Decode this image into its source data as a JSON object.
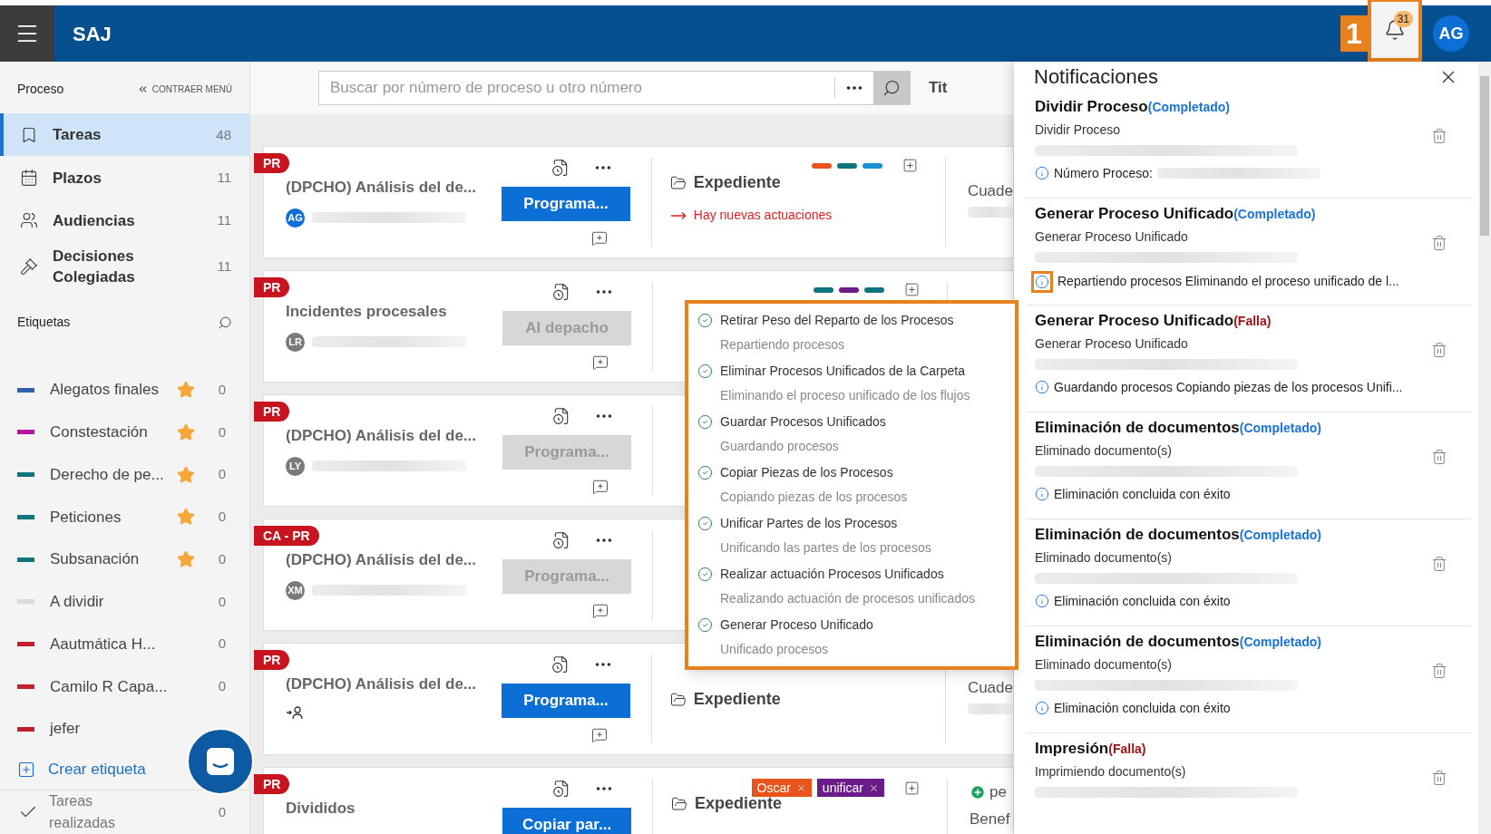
{
  "header": {
    "app_name": "SAJ",
    "callout": "1",
    "notification_count": "31",
    "user_initials": "AG"
  },
  "sidebar": {
    "section_title": "Proceso",
    "collapse_label": "CONTRAER MENÚ",
    "nav": [
      {
        "kind": "tasks",
        "label": "Tareas",
        "count": "48",
        "selected": true
      },
      {
        "kind": "calendar",
        "label": "Plazos",
        "count": "11",
        "selected": false
      },
      {
        "kind": "people",
        "label": "Audiencias",
        "count": "11",
        "selected": false
      },
      {
        "kind": "gavel",
        "label": "Decisiones Colegiadas",
        "count": "11",
        "selected": false
      }
    ],
    "labels_title": "Etiquetas",
    "labels": [
      {
        "name": "Alegatos finales",
        "color": "#2f5fae",
        "starred": true,
        "count": "0"
      },
      {
        "name": "Constestación",
        "color": "#b4169f",
        "starred": true,
        "count": "0"
      },
      {
        "name": "Derecho de pe...",
        "color": "#0e7480",
        "starred": true,
        "count": "0"
      },
      {
        "name": "Peticiones",
        "color": "#0e7480",
        "starred": true,
        "count": "0"
      },
      {
        "name": "Subsanación",
        "color": "#0e7480",
        "starred": true,
        "count": "0"
      },
      {
        "name": "A dividir",
        "color": "#dcdcdc",
        "starred": false,
        "count": "0"
      },
      {
        "name": "Aautmática H...",
        "color": "#c0202a",
        "starred": false,
        "count": "0"
      },
      {
        "name": "Camilo R Capa...",
        "color": "#c0202a",
        "starred": false,
        "count": "0"
      },
      {
        "name": "jefer",
        "color": "#c0202a",
        "starred": false
      }
    ],
    "create_label": "Crear etiqueta",
    "done": {
      "label": "Tareas realizadas",
      "count": "0"
    }
  },
  "search": {
    "placeholder": "Buscar por número de proceso u otro número",
    "column_hint": "Tit"
  },
  "cards": [
    {
      "tag": "PR",
      "title": "(DPCHO) Análisis del de...",
      "assignee": {
        "kind": "user",
        "initials": "AG",
        "color": "#0b6fd6"
      },
      "action": {
        "label": "Programa...",
        "disabled": false
      },
      "color_bars": [
        {
          "color": "#e8541c"
        },
        {
          "color": "#0e7480"
        },
        {
          "color": "#1a8fd8"
        }
      ],
      "folder": "Expediente",
      "alert": "Hay nuevas actuaciones",
      "column_3": [
        "Cuade"
      ]
    },
    {
      "tag": "PR",
      "title": "Incidentes procesales",
      "assignee": {
        "kind": "user",
        "initials": "LR",
        "color": "#7a7a7a"
      },
      "action": {
        "label": "Al depacho",
        "disabled": true
      },
      "color_bars": [
        {
          "color": "#0e7480"
        },
        {
          "color": "#6b1b8a"
        },
        {
          "color": "#0e7480"
        }
      ]
    },
    {
      "tag": "PR",
      "title": "(DPCHO) Análisis del de...",
      "assignee": {
        "kind": "user",
        "initials": "LY",
        "color": "#7a7a7a"
      },
      "action": {
        "label": "Programa...",
        "disabled": true
      }
    },
    {
      "tag": "CA - PR",
      "title": "(DPCHO) Análisis del de...",
      "assignee": {
        "kind": "user",
        "initials": "XM",
        "color": "#7a7a7a"
      },
      "action": {
        "label": "Programa...",
        "disabled": true
      }
    },
    {
      "tag": "PR",
      "title": "(DPCHO) Análisis del de...",
      "assignee": {
        "kind": "unassigned"
      },
      "action": {
        "label": "Programa...",
        "disabled": false
      },
      "folder": "Expediente",
      "column_3": [
        "Cuade"
      ]
    },
    {
      "tag": "PR",
      "title": "Divididos",
      "action": {
        "label": "Copiar par...",
        "disabled": false
      },
      "chips": [
        {
          "label": "Oscar",
          "color": "#e8541c"
        },
        {
          "label": "unificar",
          "color": "#6b1b8a"
        }
      ],
      "folder": "Expediente",
      "column_3": [
        "pe",
        "Benef"
      ]
    }
  ],
  "steps_popup": [
    {
      "title": "Retirar Peso del Reparto de los Procesos",
      "subtitle": "Repartiendo procesos"
    },
    {
      "title": "Eliminar Procesos Unificados de la Carpeta",
      "subtitle": "Eliminando el proceso unificado de los flujos"
    },
    {
      "title": "Guardar Procesos Unificados",
      "subtitle": "Guardando procesos"
    },
    {
      "title": "Copiar Piezas de los Procesos",
      "subtitle": "Copiando piezas de los procesos"
    },
    {
      "title": "Unificar Partes de los Procesos",
      "subtitle": "Unificando las partes de los procesos"
    },
    {
      "title": "Realizar actuación Procesos Unificados",
      "subtitle": "Realizando actuación de procesos unificados"
    },
    {
      "title": "Generar Proceso Unificado",
      "subtitle": "Unificado procesos"
    }
  ],
  "notifications": {
    "title": "Notificaciones",
    "items": [
      {
        "title": "Dividir Proceso",
        "status": {
          "label": "(Completado)",
          "kind": "completed"
        },
        "subtitle": "Dividir Proceso",
        "info": "Número Proceso:",
        "info_redacted": true,
        "highlighted": false
      },
      {
        "title": "Generar Proceso Unificado",
        "status": {
          "label": "(Completado)",
          "kind": "completed"
        },
        "subtitle": "Generar Proceso Unificado",
        "info": "Repartiendo procesos Eliminando el proceso unificado de l...",
        "info_redacted": false,
        "highlighted": true
      },
      {
        "title": "Generar Proceso Unificado",
        "status": {
          "label": "(Falla)",
          "kind": "failed"
        },
        "subtitle": "Generar Proceso Unificado",
        "info": "Guardando procesos Copiando piezas de los procesos Unifi...",
        "info_redacted": false,
        "highlighted": false
      },
      {
        "title": "Eliminación de documentos",
        "status": {
          "label": "(Completado)",
          "kind": "completed"
        },
        "subtitle": "Eliminado documento(s)",
        "info": "Eliminación concluida con éxito",
        "info_redacted": false,
        "highlighted": false
      },
      {
        "title": "Eliminación de documentos",
        "status": {
          "label": "(Completado)",
          "kind": "completed"
        },
        "subtitle": "Eliminado documento(s)",
        "info": "Eliminación concluida con éxito",
        "info_redacted": false,
        "highlighted": false
      },
      {
        "title": "Eliminación de documentos",
        "status": {
          "label": "(Completado)",
          "kind": "completed"
        },
        "subtitle": "Eliminado documento(s)",
        "info": "Eliminación concluida con éxito",
        "info_redacted": false,
        "highlighted": false
      },
      {
        "title": "Impresión",
        "status": {
          "label": "(Falla)",
          "kind": "failed"
        },
        "subtitle": "Imprimiendo documento(s)"
      }
    ]
  }
}
